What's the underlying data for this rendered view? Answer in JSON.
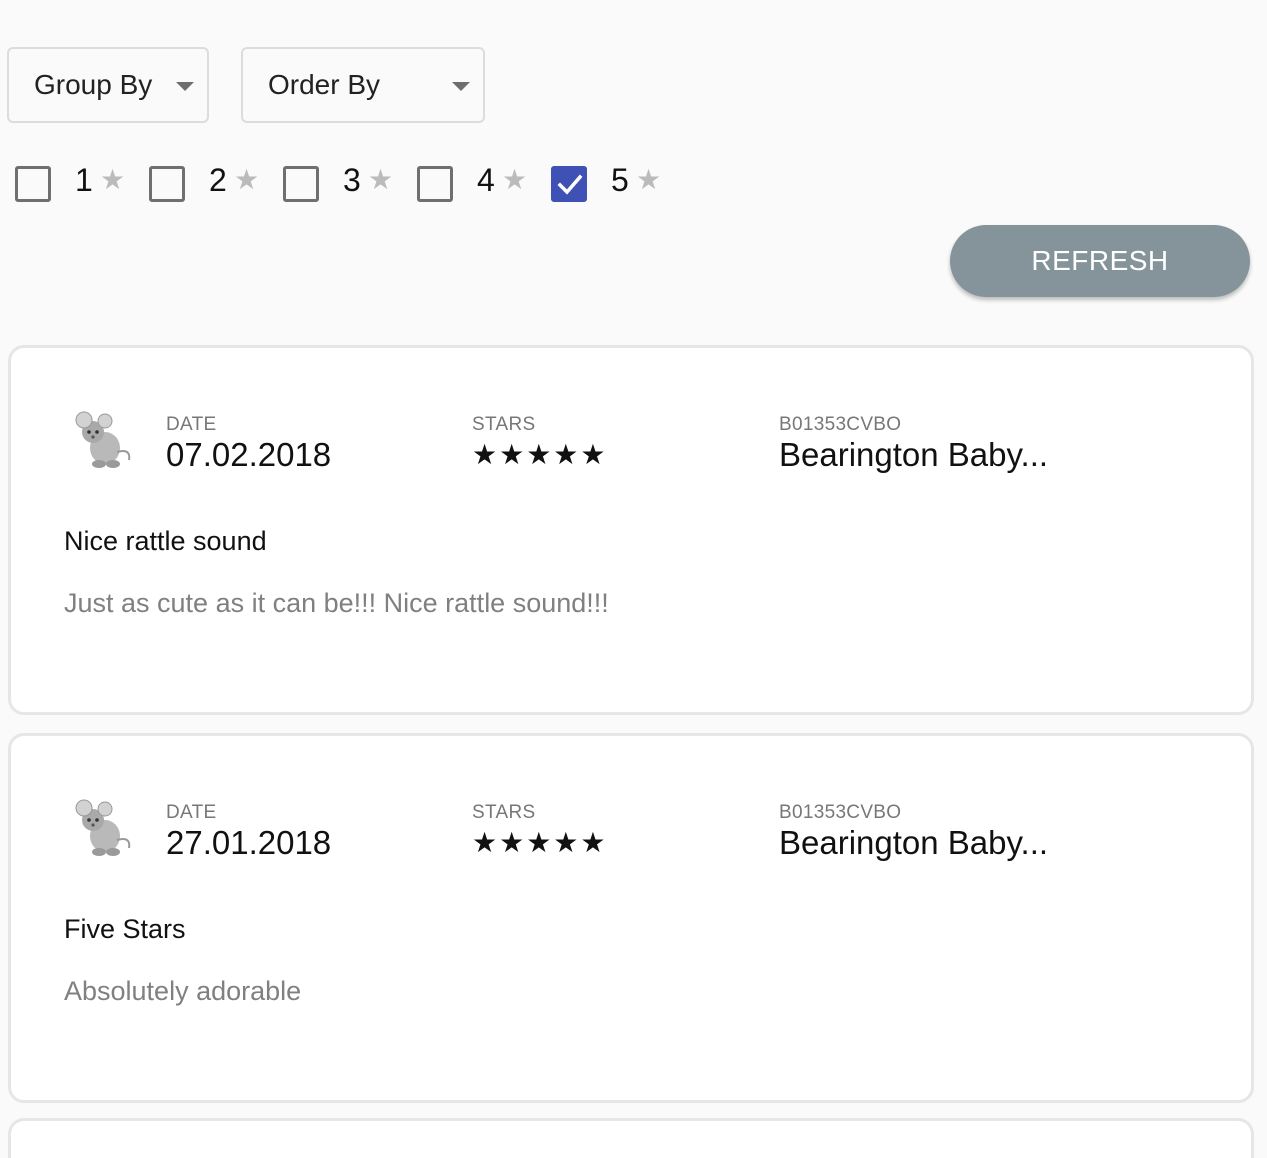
{
  "controls": {
    "group_by": "Group By",
    "order_by": "Order By",
    "refresh": "REFRESH"
  },
  "filters": [
    {
      "label": "1",
      "checked": false
    },
    {
      "label": "2",
      "checked": false
    },
    {
      "label": "3",
      "checked": false
    },
    {
      "label": "4",
      "checked": false
    },
    {
      "label": "5",
      "checked": true
    }
  ],
  "star_glyph": "★",
  "accent_color": "#3f51b5",
  "button_color": "#85949b",
  "reviews": [
    {
      "date_label": "DATE",
      "date": "07.02.2018",
      "stars_label": "STARS",
      "stars": "★★★★★",
      "rating": 5,
      "product_id": "B01353CVBO",
      "product_name": "Bearington Baby...",
      "title": "Nice rattle sound",
      "body": "Just as cute as it can be!!! Nice rattle sound!!!"
    },
    {
      "date_label": "DATE",
      "date": "27.01.2018",
      "stars_label": "STARS",
      "stars": "★★★★★",
      "rating": 5,
      "product_id": "B01353CVBO",
      "product_name": "Bearington Baby...",
      "title": "Five Stars",
      "body": "Absolutely adorable"
    }
  ]
}
